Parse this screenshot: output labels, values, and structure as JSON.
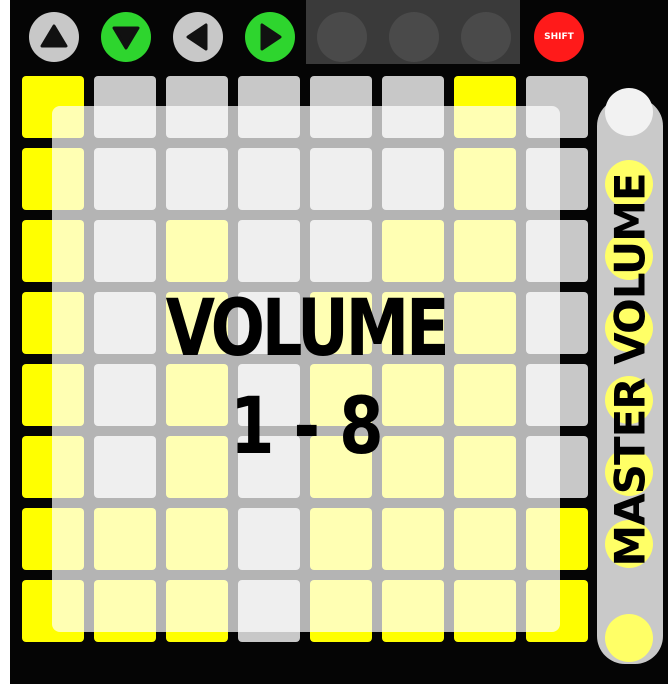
{
  "top_row": {
    "buttons": [
      {
        "name": "up-arrow-button",
        "icon": "triangle-up-icon",
        "color": "#c8c8c8",
        "glyph": "#111111"
      },
      {
        "name": "down-arrow-button",
        "icon": "triangle-down-icon",
        "color": "#2ed52e",
        "glyph": "#111111"
      },
      {
        "name": "left-arrow-button",
        "icon": "triangle-left-icon",
        "color": "#c8c8c8",
        "glyph": "#111111"
      },
      {
        "name": "right-arrow-button",
        "icon": "triangle-right-icon",
        "color": "#2ed52e",
        "glyph": "#111111"
      },
      {
        "name": "blank-button-5",
        "icon": "",
        "color": "#4a4a4a",
        "glyph": ""
      },
      {
        "name": "blank-button-6",
        "icon": "",
        "color": "#4a4a4a",
        "glyph": ""
      },
      {
        "name": "blank-button-7",
        "icon": "",
        "color": "#4a4a4a",
        "glyph": ""
      }
    ],
    "shift_label": "SHIFT",
    "shift_color": "#ff1a1a"
  },
  "pad_colors": {
    "Y": "#ffff00",
    "G": "#c8c8c8"
  },
  "grid": [
    [
      "Y",
      "G",
      "G",
      "G",
      "G",
      "G",
      "Y",
      "G"
    ],
    [
      "Y",
      "G",
      "G",
      "G",
      "G",
      "G",
      "Y",
      "G"
    ],
    [
      "Y",
      "G",
      "Y",
      "G",
      "G",
      "Y",
      "Y",
      "G"
    ],
    [
      "Y",
      "G",
      "Y",
      "G",
      "Y",
      "Y",
      "Y",
      "G"
    ],
    [
      "Y",
      "G",
      "Y",
      "G",
      "Y",
      "Y",
      "Y",
      "G"
    ],
    [
      "Y",
      "G",
      "Y",
      "G",
      "Y",
      "Y",
      "Y",
      "G"
    ],
    [
      "Y",
      "Y",
      "Y",
      "G",
      "Y",
      "Y",
      "Y",
      "Y"
    ],
    [
      "Y",
      "Y",
      "Y",
      "G",
      "Y",
      "Y",
      "Y",
      "Y"
    ]
  ],
  "master_volume": {
    "label": "MASTER VOLUME",
    "dots": [
      "G",
      "Y",
      "Y",
      "Y",
      "Y",
      "Y",
      "Y",
      "Y"
    ]
  },
  "overlay": {
    "title": "VOLUME",
    "subtitle": "1 - 8"
  }
}
